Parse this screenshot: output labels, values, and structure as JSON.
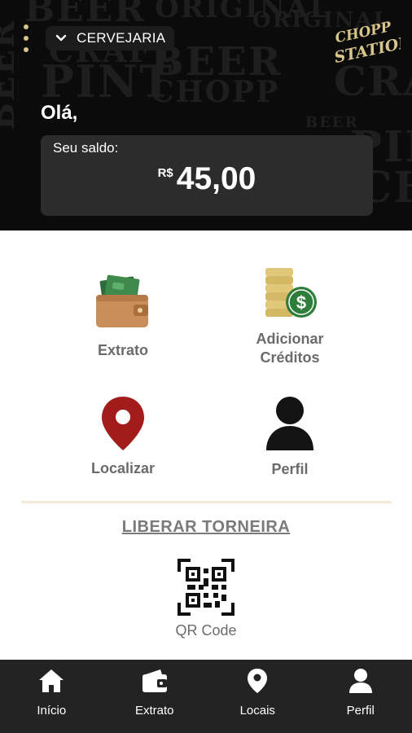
{
  "header": {
    "location": "CERVEJARIA",
    "greeting": "Olá,",
    "logo_text": "CHOPP STATION",
    "background_words": [
      "BEER",
      "ORIGINAL",
      "CRAFT",
      "PINT",
      "BEER",
      "CHOPP",
      "PINT",
      "CRAFT",
      "BEER",
      "ORIGINAL",
      "CHOPP",
      "BEER"
    ],
    "accent_color": "#d8c58a"
  },
  "balance": {
    "label": "Seu saldo:",
    "currency": "R$",
    "amount": "45,00"
  },
  "actions": [
    {
      "label": "Extrato",
      "icon": "wallet-icon"
    },
    {
      "label": "Adicionar\nCréditos",
      "icon": "coins-dollar-icon"
    },
    {
      "label": "Localizar",
      "icon": "location-pin-icon"
    },
    {
      "label": "Perfil",
      "icon": "person-icon"
    }
  ],
  "liberar": {
    "label": "LIBERAR TORNEIRA",
    "qr_label": "QR Code"
  },
  "bottom_nav": [
    {
      "label": "Início",
      "icon": "home-icon"
    },
    {
      "label": "Extrato",
      "icon": "wallet-icon"
    },
    {
      "label": "Locais",
      "icon": "location-pin-icon"
    },
    {
      "label": "Perfil",
      "icon": "person-icon"
    }
  ],
  "colors": {
    "header_bg": "#0b0b0b",
    "card_bg": "#2c2c2c",
    "nav_bg": "#232323",
    "pin_red": "#a31c1c"
  }
}
